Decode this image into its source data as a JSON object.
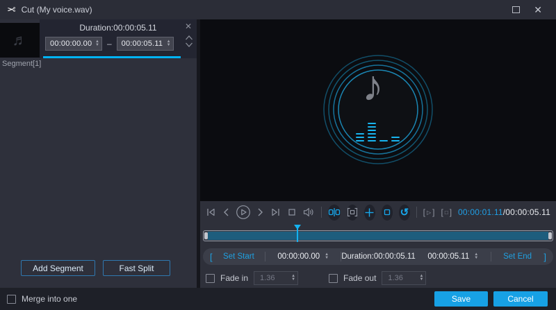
{
  "window": {
    "title": "Cut (My voice.wav)"
  },
  "glyphs": {
    "scissors": "✂",
    "close": "✕",
    "remove_segment": "✕",
    "note_thumb": "♬",
    "note_large": "♪",
    "reset": "↺",
    "bracket_open": "[",
    "bracket_close": "]",
    "triangle_small": "▷",
    "square_small": "□",
    "range_dash": "–",
    "slash": "/",
    "spin_up": "▲",
    "spin_down": "▼"
  },
  "segment_panel": {
    "duration_label": "Duration:00:00:05.11",
    "start_value": "00:00:00.00",
    "end_value": "00:00:05.11",
    "segment_label": "Segment[1]",
    "add_segment": "Add Segment",
    "fast_split": "Fast Split"
  },
  "player": {
    "current_time": "00:00:01.11",
    "total_time": "00:00:05.11",
    "playhead_percent": 27
  },
  "trim": {
    "set_start": "Set Start",
    "start_value": "00:00:00.00",
    "duration_label": "Duration:00:00:05.11",
    "end_value": "00:00:05.11",
    "set_end": "Set End"
  },
  "fade": {
    "fade_in_label": "Fade in",
    "fade_in_value": "1.36",
    "fade_out_label": "Fade out",
    "fade_out_value": "1.36"
  },
  "footer": {
    "merge_label": "Merge into one",
    "save": "Save",
    "cancel": "Cancel"
  },
  "colors": {
    "accent": "#17a1e5",
    "cyan_line": "#00b3f5",
    "timeline_fill": "#1d5d7d",
    "ring_teal": "#1b87b4",
    "icon_gray": "#9095a1"
  }
}
